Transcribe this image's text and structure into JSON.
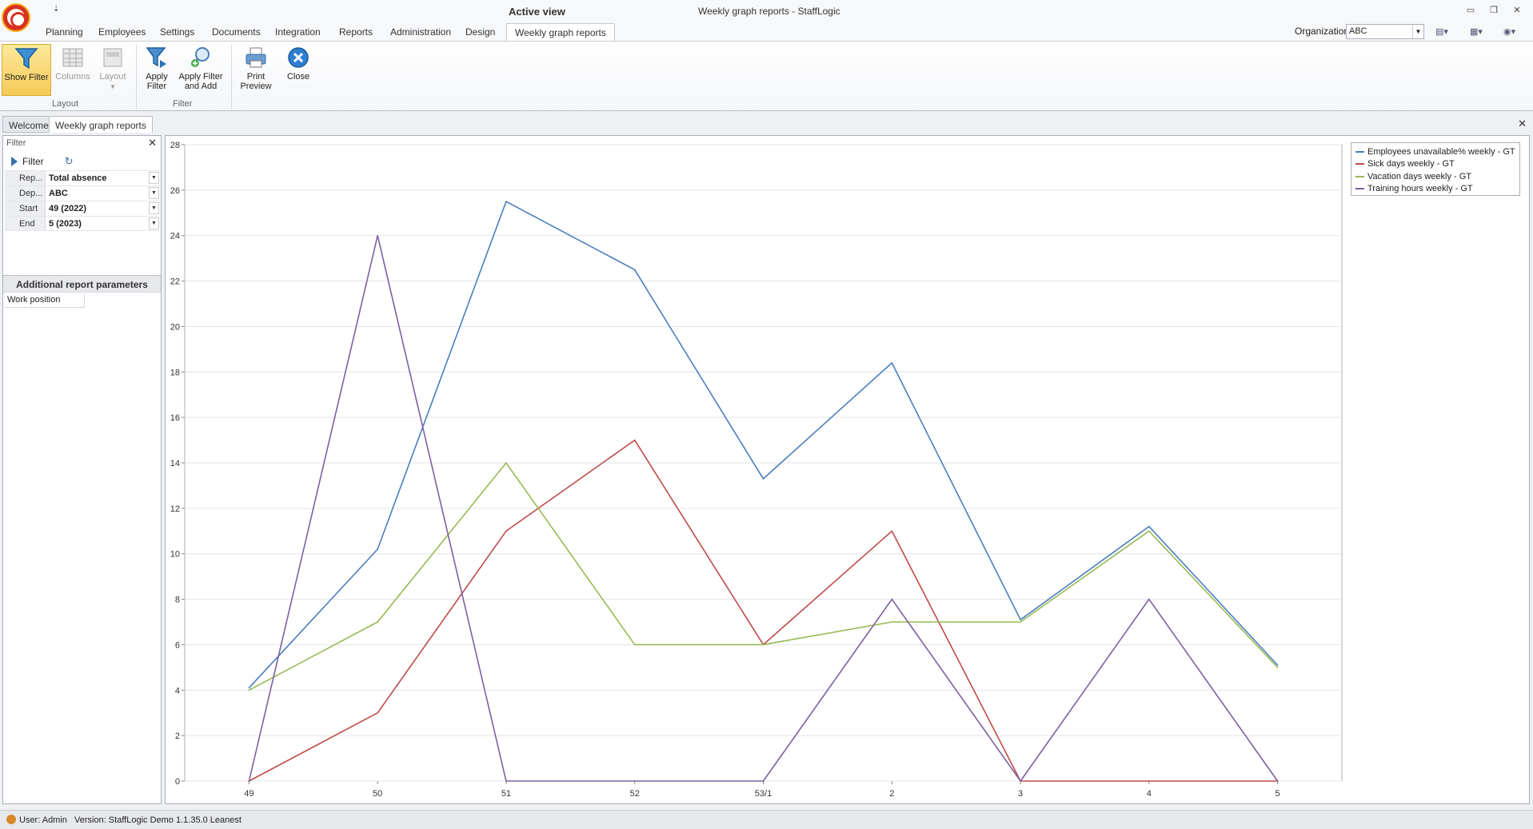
{
  "window": {
    "active_view": "Active view",
    "title": "Weekly graph reports - StaffLogic",
    "qat": "⇣"
  },
  "ribbon_tabs": [
    "Planning",
    "Employees",
    "Settings",
    "Documents",
    "Integration",
    "Reports",
    "Administration",
    "Design",
    "Weekly graph reports"
  ],
  "organization": {
    "label": "Organization",
    "value": "ABC"
  },
  "ribbon": {
    "show_filter": "Show Filter",
    "columns": "Columns",
    "layout": "Layout",
    "apply_filter": "Apply Filter",
    "apply_filter_add": "Apply Filter and Add",
    "print_preview": "Print Preview",
    "close": "Close",
    "group_layout": "Layout",
    "group_filter": "Filter"
  },
  "doc_tabs": [
    "Welcome",
    "Weekly graph reports"
  ],
  "filter_panel": {
    "title": "Filter",
    "filter_button": "Filter",
    "rows": [
      {
        "label": "Rep...",
        "value": "Total absence"
      },
      {
        "label": "Dep...",
        "value": "ABC"
      },
      {
        "label": "Start",
        "value": "49 (2022)"
      },
      {
        "label": "End",
        "value": "5 (2023)"
      }
    ],
    "additional_title": "Additional report parameters",
    "work_position": "Work position"
  },
  "chart_data": {
    "type": "line",
    "categories": [
      "49",
      "50",
      "51",
      "52",
      "53/1",
      "2",
      "3",
      "4",
      "5"
    ],
    "ylim": [
      0,
      28
    ],
    "yticks": [
      0,
      2,
      4,
      6,
      8,
      10,
      12,
      14,
      16,
      18,
      20,
      22,
      24,
      26,
      28
    ],
    "grid": true,
    "legend_position": "top-right",
    "series": [
      {
        "name": "Employees unavailable% weekly - GT",
        "color": "#4a7ebb",
        "values": [
          4.1,
          10.2,
          25.5,
          22.5,
          13.3,
          18.4,
          7.1,
          11.2,
          5.1
        ]
      },
      {
        "name": "Sick days weekly - GT",
        "color": "#be4b48",
        "values": [
          0,
          3,
          11,
          15,
          6,
          11,
          0,
          0,
          0
        ]
      },
      {
        "name": "Vacation days weekly - GT",
        "color": "#98b954",
        "values": [
          4,
          7,
          14,
          6,
          6,
          7,
          7,
          11,
          5
        ]
      },
      {
        "name": "Training hours weekly - GT",
        "color": "#7d60a0",
        "values": [
          0,
          24,
          0,
          0,
          0,
          8,
          0,
          8,
          0
        ]
      }
    ]
  },
  "status": {
    "user": "User: Admin",
    "version": "Version: StaffLogic Demo 1.1.35.0 Leanest"
  }
}
